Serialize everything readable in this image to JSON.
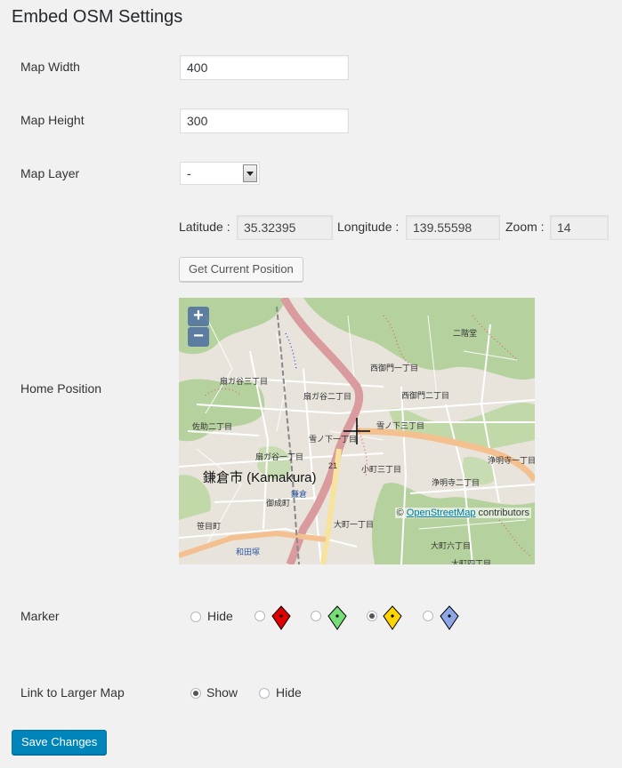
{
  "page": {
    "title": "Embed OSM Settings"
  },
  "fields": {
    "map_width": {
      "label": "Map Width",
      "value": "400"
    },
    "map_height": {
      "label": "Map Height",
      "value": "300"
    },
    "map_layer": {
      "label": "Map Layer",
      "value": "-"
    }
  },
  "home_position": {
    "label": "Home Position",
    "latitude_label": "Latitude :",
    "latitude": "35.32395",
    "longitude_label": "Longitude :",
    "longitude": "139.55598",
    "zoom_label": "Zoom :",
    "zoom": "14",
    "button": "Get Current Position",
    "map": {
      "zoom_in": "+",
      "zoom_out": "−",
      "attribution_prefix": "©",
      "attribution_link": "OpenStreetMap",
      "attribution_suffix": "contributors",
      "city_label": "鎌倉市 (Kamakura)",
      "place_labels": [
        "二階堂",
        "西御門一丁目",
        "西御門二丁目",
        "扇ガ谷二丁目",
        "扇ガ谷三丁目",
        "扇ガ谷一丁目",
        "雪ノ下三丁目",
        "雪ノ下一丁目",
        "小町三丁目",
        "浄明寺一丁目",
        "浄明寺二丁目",
        "御成町",
        "大町一丁目",
        "大町六丁目",
        "大町四丁目",
        "佐助二丁目",
        "笹目町",
        "和田塚",
        "鎌倉",
        "21"
      ]
    }
  },
  "marker": {
    "label": "Marker",
    "options": [
      {
        "label": "Hide",
        "checked": false
      },
      {
        "icon": "red-marker-icon",
        "color": "#e00000",
        "checked": false
      },
      {
        "icon": "green-marker-icon",
        "color": "#77dd77",
        "checked": false
      },
      {
        "icon": "yellow-marker-icon",
        "color": "#ffd400",
        "checked": true
      },
      {
        "icon": "blue-marker-icon",
        "color": "#8ea6e8",
        "checked": false
      }
    ]
  },
  "link_larger_map": {
    "label": "Link to Larger Map",
    "show_label": "Show",
    "hide_label": "Hide",
    "selected": "Show"
  },
  "save_button": "Save Changes"
}
